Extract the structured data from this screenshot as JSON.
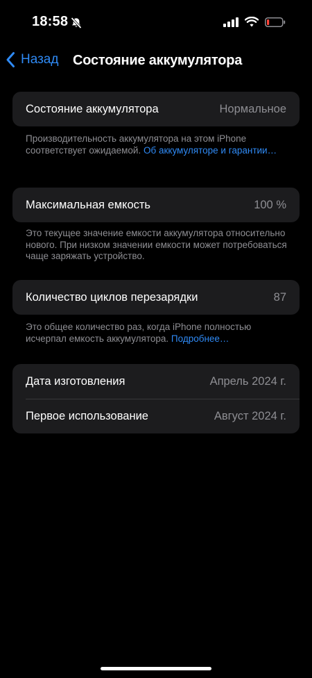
{
  "status_bar": {
    "time": "18:58",
    "icons": [
      "bell-slash-icon",
      "cellular-signal-icon",
      "wifi-icon",
      "battery-low-icon"
    ],
    "battery_color": "#ff453a"
  },
  "nav": {
    "back_label": "Назад",
    "title": "Состояние аккумулятора",
    "accent_color": "#2f8af5"
  },
  "battery_health": {
    "label": "Состояние аккумулятора",
    "value": "Нормальное",
    "footnote_text": "Производительность аккумулятора на этом iPhone соответствует ожидаемой. ",
    "footnote_link": "Об аккумуляторе и гарантии…"
  },
  "max_capacity": {
    "label": "Максимальная емкость",
    "value": "100 %",
    "footnote_text": "Это текущее значение емкости аккумулятора относительно нового. При низком значении емкости может потребоваться чаще заряжать устройство."
  },
  "cycle_count": {
    "label": "Количество циклов перезарядки",
    "value": "87",
    "footnote_text": "Это общее количество раз, когда iPhone полностью исчерпал емкость аккумулятора. ",
    "footnote_link": "Подробнее…"
  },
  "dates": {
    "manufacture_label": "Дата изготовления",
    "manufacture_value": "Апрель 2024 г.",
    "first_use_label": "Первое использование",
    "first_use_value": "Август 2024 г."
  }
}
